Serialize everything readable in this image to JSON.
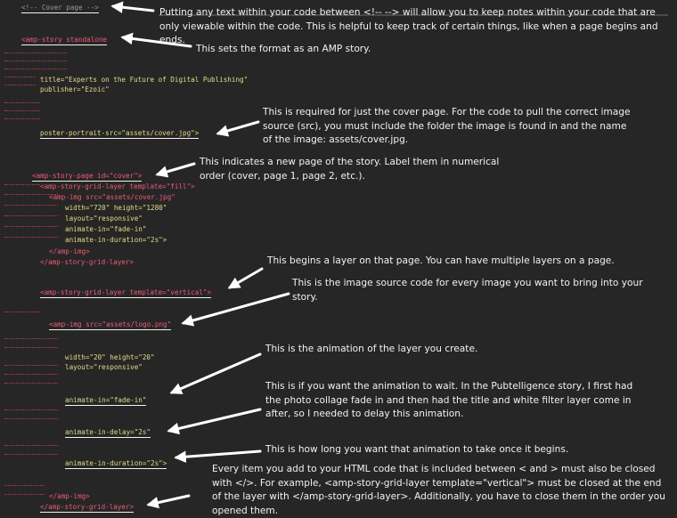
{
  "code_lines": {
    "cover_comment": "<!-- Cover page -->",
    "amp_story_standalone": "<amp-story standalone",
    "title_attr": "title=\"Experts on the Future of Digital Publishing\"",
    "publisher_attr": "publisher=\"Ezoic\"",
    "poster_attr": "poster-portrait-src=\"assets/cover.jpg\">",
    "story_page": "<amp-story-page id=\"cover\">",
    "grid_layer_fill": "<amp-story-grid-layer template=\"fill\">",
    "amp_img_cover": "<amp-img src=\"assets/cover.jpg\"",
    "width_height_cover": "width=\"720\" height=\"1280\"",
    "layout_responsive_1": "layout=\"responsive\"",
    "animate_in_fade_1": "animate-in=\"fade-in\"",
    "animate_in_duration_1": "animate-in-duration=\"2s\">",
    "close_amp_img_1": "</amp-img>",
    "close_grid_layer_1": "</amp-story-grid-layer>",
    "grid_layer_vertical": "<amp-story-grid-layer template=\"vertical\">",
    "amp_img_logo": "<amp-img src=\"assets/logo.png\"",
    "width_height_logo": "width=\"20\" height=\"20\"",
    "layout_responsive_2": "layout=\"responsive\"",
    "animate_in_fade_2": "animate-in=\"fade-in\"",
    "animate_in_delay": "animate-in-delay=\"2s\"",
    "animate_in_duration_2": "animate-in-duration=\"2s\">",
    "close_amp_img_2": "</amp-img>",
    "close_grid_layer_2": "</amp-story-grid-layer>"
  },
  "annotations": {
    "comment_note": "Putting any text within your code between <!--   --> will allow you to keep notes within your code that are only viewable within the code. This is helpful to keep track of certain things, like when a page begins and ends.",
    "format_note": "This sets the format as an AMP story.",
    "cover_note": "This is required for just the cover page. For the code to pull the correct image source (src), you must include the folder the image is found in and the name of the image: assets/cover.jpg.",
    "new_page_note": "This indicates a new page of the story. Label them in numerical order (cover, page 1, page 2, etc.).",
    "layer_note": "This begins a layer on that page. You can have multiple layers on a page.",
    "image_source_note": "This is the image source code for every image you want to bring into your story.",
    "animation_note": "This is the animation of the layer you create.",
    "wait_note": "This is if you want the animation to wait. In the Pubtelligence story, I first had the photo collage fade in and then had the title and white filter layer come in after, so I needed to delay this animation.",
    "duration_note": "This is how long you want that animation to take once it begins.",
    "closing_note": "Every item you add to your HTML code that is included between < and > must also be closed with </>. For example, <amp-story-grid-layer template=\"vertical\"> must be closed at the end of the layer with </amp-story-grid-layer>. Additionally, you have to close them in the order you opened them."
  },
  "colors": {
    "background": "#262626",
    "attribute_text": "#e6dc85",
    "tag_text": "#f05a7a",
    "comment_text": "#9a9a9a",
    "note_text": "#f2f2f2",
    "arrow": "#ffffff"
  }
}
